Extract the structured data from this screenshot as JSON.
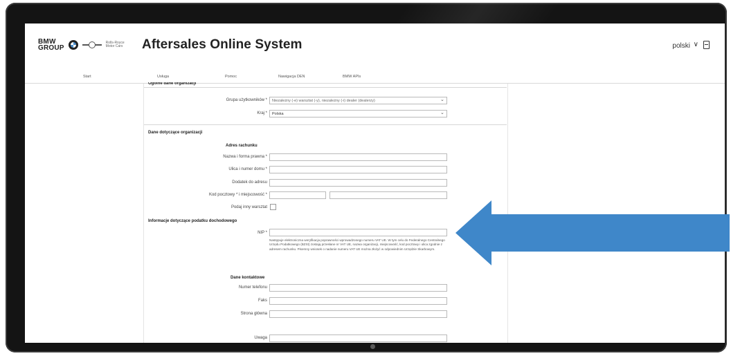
{
  "header": {
    "brand_text": "BMW GROUP",
    "title": "Aftersales Online System",
    "language": "polski",
    "icons": {
      "language_chevron": "chevron-down-icon",
      "logout": "logout-icon"
    }
  },
  "nav": {
    "items": [
      "Start",
      "Usługa",
      "Pomoc",
      "Nawigacja DEN",
      "BMW APIs"
    ]
  },
  "general_section": {
    "heading": "Ogólne dane organizacji",
    "user_group_label": "Grupa użytkowników *",
    "user_group_value": "Niezależny (-e) warsztat (-y), niezależny (-i) dealer (dealerzy)",
    "country_label": "Kraj *",
    "country_value": "Polska"
  },
  "organization_section": {
    "heading": "Dane dotyczące organizacji",
    "billing_heading": "Adres rachunku",
    "name_label": "Nazwa i forma prawna *",
    "street_label": "Ulica i numer domu *",
    "address_extra_label": "Dodatek do adresu",
    "postal_city_label": "Kod pocztowy *  i miejscowość *",
    "other_workshop_label": "Podaj inny warsztat"
  },
  "tax_section": {
    "heading": "Informacje dotyczące podatku dochodowego",
    "nip_label": "NIP *",
    "nip_help": "Następuje elektroniczna weryfikacja poprawności wprowadzonego numeru VAT UE. W tym celu do Federalnego Centralnego Urzędu Podatkowego (BZSt) zostają przesłane nr VAT UE, nazwa organizacji, miejscowość, kod pocztowy i ulica zgodnie z adresem rachunku. Pisemny wniosek o nadanie numeru VAT UE można złożyć w odpowiednim Urzędzie Skarbowym."
  },
  "contact_section": {
    "heading": "Dane kontaktowe",
    "phone_label": "Numer telefonu",
    "fax_label": "Faks",
    "website_label": "Strona główna",
    "note_label": "Uwaga"
  },
  "colors": {
    "arrow": "#3f87c9",
    "bezel": "#141414"
  }
}
